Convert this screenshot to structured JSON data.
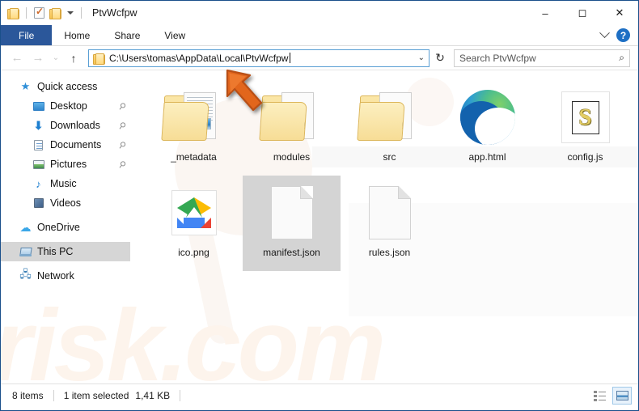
{
  "window": {
    "title": "PtvWcfpw",
    "quick_access_toolbar": [
      {
        "name": "folder-icon",
        "label": "Folder"
      },
      {
        "name": "properties-icon",
        "label": "Properties"
      },
      {
        "name": "new-folder-icon",
        "label": "New folder"
      },
      {
        "name": "customize-caret-icon",
        "label": "Customize Quick Access Toolbar"
      }
    ],
    "controls": {
      "minimize": "–",
      "maximize": "◻",
      "close": "✕"
    }
  },
  "ribbon": {
    "tabs": [
      {
        "label": "File",
        "active": true
      },
      {
        "label": "Home",
        "active": false
      },
      {
        "label": "Share",
        "active": false
      },
      {
        "label": "View",
        "active": false
      }
    ],
    "expand_label": "⌄",
    "help_label": "?"
  },
  "address_row": {
    "back_label": "←",
    "forward_label": "→",
    "recent_label": "⌄",
    "up_label": "↑",
    "path": "C:\\Users\\tomas\\AppData\\Local\\PtvWcfpw",
    "dropdown_label": "⌄",
    "refresh_label": "↻",
    "search_placeholder": "Search PtvWcfpw",
    "search_icon": "⌕"
  },
  "sidebar": {
    "items": [
      {
        "label": "Quick access",
        "icon": "star-icon",
        "indent": 0,
        "pinned": false,
        "selected": false
      },
      {
        "label": "Desktop",
        "icon": "desktop-icon",
        "indent": 1,
        "pinned": true,
        "selected": false
      },
      {
        "label": "Downloads",
        "icon": "downloads-icon",
        "indent": 1,
        "pinned": true,
        "selected": false
      },
      {
        "label": "Documents",
        "icon": "documents-icon",
        "indent": 1,
        "pinned": true,
        "selected": false
      },
      {
        "label": "Pictures",
        "icon": "pictures-icon",
        "indent": 1,
        "pinned": true,
        "selected": false
      },
      {
        "label": "Music",
        "icon": "music-icon",
        "indent": 1,
        "pinned": false,
        "selected": false
      },
      {
        "label": "Videos",
        "icon": "videos-icon",
        "indent": 1,
        "pinned": false,
        "selected": false
      },
      {
        "label": "OneDrive",
        "icon": "cloud-icon",
        "indent": 0,
        "pinned": false,
        "selected": false
      },
      {
        "label": "This PC",
        "icon": "this-pc-icon",
        "indent": 0,
        "pinned": false,
        "selected": true
      },
      {
        "label": "Network",
        "icon": "network-icon",
        "indent": 0,
        "pinned": false,
        "selected": false
      }
    ],
    "pin_glyph": "📌"
  },
  "files": [
    {
      "name": "_metadata",
      "type": "folder-preview",
      "selected": false
    },
    {
      "name": "modules",
      "type": "folder-js",
      "selected": false
    },
    {
      "name": "src",
      "type": "folder-js",
      "selected": false
    },
    {
      "name": "app.html",
      "type": "edge-html",
      "selected": false
    },
    {
      "name": "config.js",
      "type": "js-script",
      "selected": false
    },
    {
      "name": "ico.png",
      "type": "drive-image",
      "selected": false
    },
    {
      "name": "manifest.json",
      "type": "blank-page",
      "selected": true
    },
    {
      "name": "rules.json",
      "type": "blank-page",
      "selected": false
    }
  ],
  "status_bar": {
    "item_count": "8 items",
    "selection": "1 item selected",
    "selection_size": "1,41 KB",
    "view_details_label": "Details view",
    "view_large_icons_label": "Large icons view"
  },
  "annotation": {
    "arrow_name": "orange-pointer-arrow",
    "arrow_color": "#e2661f"
  },
  "watermark": {
    "text": "risk.com"
  },
  "colors": {
    "accent": "#2b579a",
    "selection": "#d4d4d4",
    "frame": "#1a4f8a",
    "folder": "#f3d484"
  }
}
